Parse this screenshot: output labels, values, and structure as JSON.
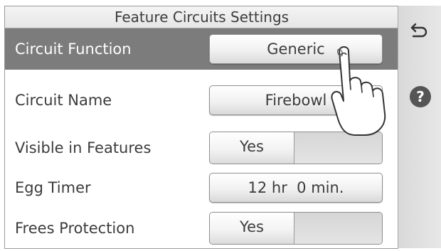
{
  "header": {
    "title": "Feature Circuits Settings"
  },
  "rows": [
    {
      "label": "Circuit Function",
      "value": "Generic",
      "selected": true
    },
    {
      "label": "Circuit Name",
      "value": "Firebowl"
    },
    {
      "label": "Visible in Features",
      "toggle": "Yes"
    },
    {
      "label": "Egg Timer",
      "value": "12 hr  0 min."
    },
    {
      "label": "Frees Protection",
      "toggle": "Yes"
    }
  ],
  "sidebar": {
    "back_icon": "back-arrow-icon",
    "help_label": "?"
  },
  "colors": {
    "selected_row": "#7c7c7c",
    "sidebar": "#e0e0e0",
    "help_button": "#555555"
  }
}
